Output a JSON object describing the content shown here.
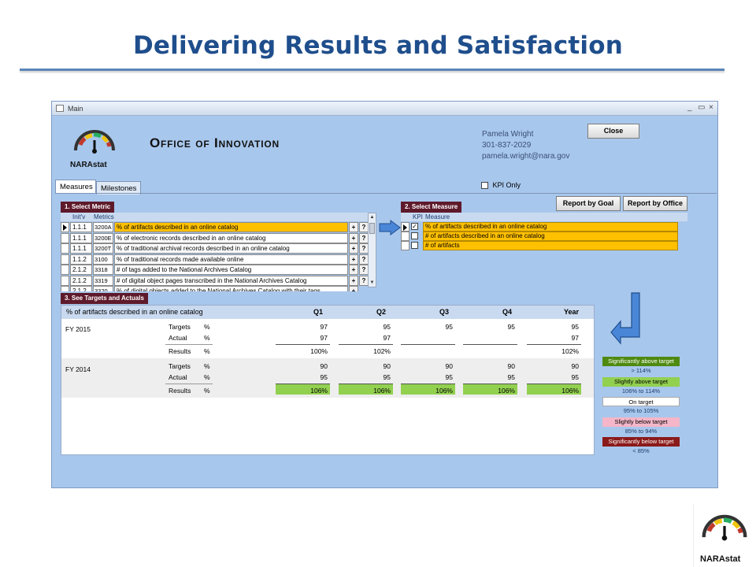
{
  "slide": {
    "title": "Delivering Results and Satisfaction"
  },
  "window": {
    "title": "Main",
    "controls": [
      "_",
      "▭",
      "×"
    ]
  },
  "logo": {
    "text": "NARAstat"
  },
  "header": {
    "office_title": "Office of Innovation",
    "contact": {
      "name": "Pamela Wright",
      "phone": "301-837-2029",
      "email": "pamela.wright@nara.gov"
    },
    "close_label": "Close",
    "kpi_only_label": "KPI Only"
  },
  "tabs": [
    {
      "label": "Measures",
      "active": true
    },
    {
      "label": "Milestones",
      "active": false
    }
  ],
  "metrics": {
    "section_label": "1. Select Metric",
    "col_init": "Init'v",
    "col_metrics": "Metrics",
    "rows": [
      {
        "init": "1.1.1",
        "code": "3200A",
        "desc": "% of artifacts described in an online catalog",
        "selected": true
      },
      {
        "init": "1.1.1",
        "code": "3200E",
        "desc": "% of electronic records described in an online catalog",
        "selected": false
      },
      {
        "init": "1.1.1",
        "code": "3200T",
        "desc": "% of traditional archival records described in an online catalog",
        "selected": false
      },
      {
        "init": "1.1.2",
        "code": "3100",
        "desc": "% of traditional records made available online",
        "selected": false
      },
      {
        "init": "2.1.2",
        "code": "3318",
        "desc": "# of tags added to the National Archives Catalog",
        "selected": false
      },
      {
        "init": "2.1.2",
        "code": "3319",
        "desc": "# of digital object pages transcribed in the National Archives Catalog",
        "selected": false
      },
      {
        "init": "2.1.2",
        "code": "3320",
        "desc": "% of digital objects added to the National Archives Catalog with their tags",
        "selected": false
      }
    ],
    "plus": "+",
    "help": "?"
  },
  "measures": {
    "section_label": "2. Select Measure",
    "report_goal": "Report by Goal",
    "report_office": "Report by Office",
    "col_kpi": "KPI",
    "col_measure": "Measure",
    "rows": [
      {
        "kpi": true,
        "desc": "% of artifacts described in an online catalog",
        "selected": true
      },
      {
        "kpi": false,
        "desc": "# of artifacts described in an online catalog",
        "selected": false
      },
      {
        "kpi": false,
        "desc": "# of artifacts",
        "selected": false
      }
    ]
  },
  "targets": {
    "section_label": "3. See Targets and Actuals",
    "measure_name": "% of artifacts described in an online catalog",
    "columns": [
      "Q1",
      "Q2",
      "Q3",
      "Q4",
      "Year"
    ],
    "labels": {
      "targets": "Targets",
      "actual": "Actual",
      "results": "Results",
      "pct": "%"
    },
    "years": [
      {
        "fy": "FY  2015",
        "targets": [
          "97",
          "95",
          "95",
          "95",
          "95"
        ],
        "actual": [
          "97",
          "97",
          "",
          "",
          "97"
        ],
        "results": [
          "100%",
          "102%",
          "",
          "",
          "102%"
        ]
      },
      {
        "fy": "FY  2014",
        "targets": [
          "90",
          "90",
          "90",
          "90",
          "90"
        ],
        "actual": [
          "95",
          "95",
          "95",
          "95",
          "95"
        ],
        "results": [
          "106%",
          "106%",
          "106%",
          "106%",
          "106%"
        ]
      }
    ]
  },
  "legend": [
    {
      "label": "Significantly above target",
      "range": "> 114%",
      "bg": "#4f8a10",
      "fg": "#ffffff"
    },
    {
      "label": "Slightly above target",
      "range": "106% to 114%",
      "bg": "#92d050",
      "fg": "#000000"
    },
    {
      "label": "On target",
      "range": "95% to 105%",
      "bg": "#ffffff",
      "fg": "#000000"
    },
    {
      "label": "Slightly below target",
      "range": "85% to 94%",
      "bg": "#f4b6c8",
      "fg": "#000000"
    },
    {
      "label": "Significantly below target",
      "range": "< 85%",
      "bg": "#8b1a1a",
      "fg": "#ffffff"
    }
  ],
  "colors": {
    "title_blue": "#1f4e8c",
    "window_bg": "#a8c7ec",
    "section_label_bg": "#5e1a2b",
    "highlight": "#ffc000",
    "green_result": "#92d050"
  }
}
